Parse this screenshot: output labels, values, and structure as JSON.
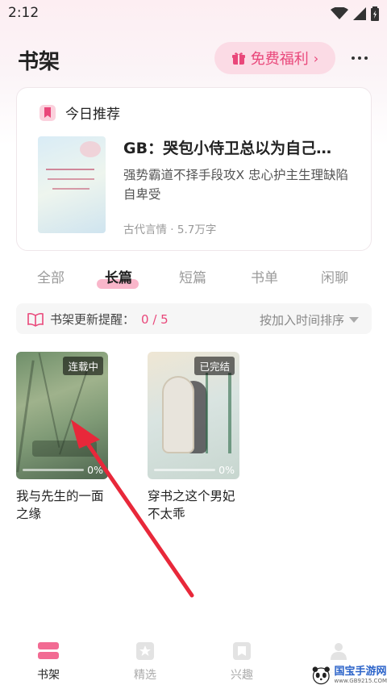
{
  "status_bar": {
    "time": "2:12"
  },
  "header": {
    "title": "书架",
    "welfare_label": "免费福利"
  },
  "recommendation": {
    "heading": "今日推荐",
    "book_title": "GB：哭包小侍卫总以为自己…",
    "description": "强势霸道不择手段攻X 忠心护主生理缺陷自卑受",
    "meta": "古代言情 · 5.7万字"
  },
  "tabs": [
    {
      "label": "全部"
    },
    {
      "label": "长篇"
    },
    {
      "label": "短篇"
    },
    {
      "label": "书单"
    },
    {
      "label": "闲聊"
    }
  ],
  "active_tab": "长篇",
  "update_bar": {
    "label": "书架更新提醒：",
    "count": "0 / 5",
    "sort_label": "按加入时间排序"
  },
  "books": [
    {
      "title": "我与先生的一面之缘",
      "badge": "连载中",
      "progress": "0%",
      "progress_value": 0
    },
    {
      "title": "穿书之这个男妃不太乖",
      "badge": "已完结",
      "progress": "0%",
      "progress_value": 0
    }
  ],
  "bottom_nav": [
    {
      "label": "书架"
    },
    {
      "label": "精选"
    },
    {
      "label": "兴趣"
    },
    {
      "label": "我的"
    }
  ],
  "watermark": {
    "text": "国宝手游网",
    "sub": "www.GB9215.COM"
  },
  "colors": {
    "accent": "#e9477a",
    "accent_soft": "#fbdbe5",
    "arrow": "#e8283a"
  },
  "icons": {
    "wifi": "wifi-icon",
    "signal": "signal-icon",
    "battery": "battery-icon",
    "gift": "gift-icon",
    "more": "more-icon",
    "recommend": "bookmark-icon",
    "book_open": "book-open-icon",
    "sort": "caret-down-icon"
  }
}
